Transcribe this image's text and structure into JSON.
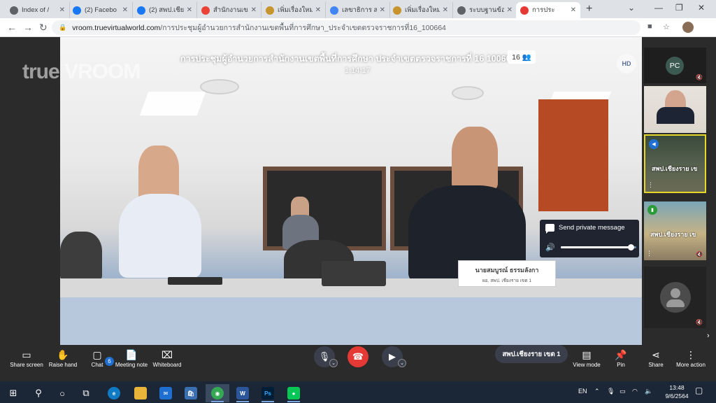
{
  "browser": {
    "tabs": [
      {
        "title": "Index of /",
        "icon": "globe-icon",
        "color": "#5f6368"
      },
      {
        "title": "(2) Facebo",
        "icon": "facebook-icon",
        "color": "#1877f2"
      },
      {
        "title": "(2) สพป.เชีย",
        "icon": "facebook-icon",
        "color": "#1877f2"
      },
      {
        "title": "สำนักงานเขต",
        "icon": "gmail-icon",
        "color": "#ea4335"
      },
      {
        "title": "เพิ่มเรื่องใหม่",
        "icon": "emblem-icon",
        "color": "#c8952c"
      },
      {
        "title": "เลขาธิการ ส",
        "icon": "google-icon",
        "color": "#4285f4"
      },
      {
        "title": "เพิ่มเรื่องใหม่",
        "icon": "emblem-icon",
        "color": "#c8952c"
      },
      {
        "title": "ระบบฐานข้อ",
        "icon": "globe-icon",
        "color": "#5f6368"
      },
      {
        "title": "การประ",
        "icon": "vroom-icon",
        "color": "#e53935"
      }
    ],
    "url_host": "vroom.truevirtualworld.com",
    "url_path": "/การประชุมผู้อำนวยการสำนักงานเขตพื้นที่การศึกษา_ประจำเขตตรวจราชการที่16_100664"
  },
  "meeting": {
    "watermark": "true VROOM",
    "title": "การประชุมผู้อำนวยการสำนักงานเขตพื้นที่การศึกษา ประจำเขตตรวจราชการที่ 16 100664",
    "timer": "1:14:17",
    "participant_count": "16",
    "hd_label": "HD",
    "nameplate": "นายสมบูรณ์  ธรรมลังกา",
    "nameplate_sub": "ผอ. สพป. เชียงราย เขต 1"
  },
  "popup": {
    "private_message": "Send private message",
    "volume": 0.93
  },
  "thumbnails": [
    {
      "type": "avatar",
      "initials": "PC"
    },
    {
      "type": "video-woman"
    },
    {
      "type": "video",
      "label": "สพป.เชียงราย เข",
      "active": true
    },
    {
      "type": "video",
      "label": "สพป.เชียงราย เข",
      "active": false
    },
    {
      "type": "placeholder"
    }
  ],
  "controls": {
    "share_screen": "Share screen",
    "raise_hand": "Raise hand",
    "chat": "Chat",
    "chat_badge": "6",
    "meeting_note": "Meeting note",
    "whiteboard": "Whiteboard",
    "speaker_name": "สพป.เชียงราย เขต 1",
    "view_mode": "View mode",
    "pin": "Pin",
    "share": "Share",
    "more_action": "More action"
  },
  "taskbar": {
    "language": "EN",
    "time": "13:48",
    "date": "9/6/2564"
  }
}
